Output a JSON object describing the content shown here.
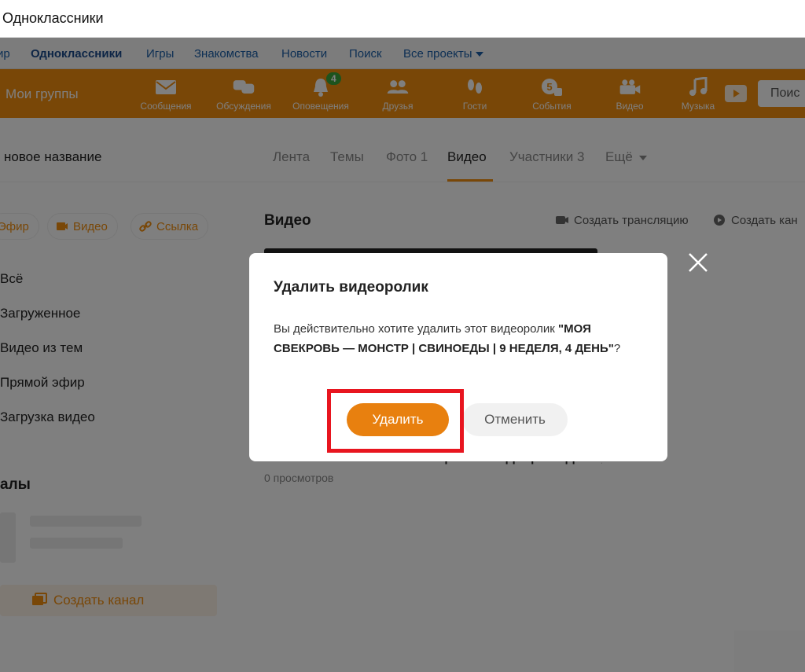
{
  "browser": {
    "title": "Одноклассники"
  },
  "topnav": {
    "items": [
      {
        "label": "ир"
      },
      {
        "label": "Одноклассники",
        "active": true
      },
      {
        "label": "Игры"
      },
      {
        "label": "Знакомства"
      },
      {
        "label": "Новости"
      },
      {
        "label": "Поиск"
      },
      {
        "label": "Все проекты"
      }
    ]
  },
  "toolbar": {
    "group_title": "Мои группы",
    "items": [
      {
        "label": "Сообщения",
        "icon": "envelope-icon"
      },
      {
        "label": "Обсуждения",
        "icon": "chat-bubbles-icon"
      },
      {
        "label": "Оповещения",
        "icon": "bell-icon",
        "badge": "4"
      },
      {
        "label": "Друзья",
        "icon": "friends-icon"
      },
      {
        "label": "Гости",
        "icon": "footprints-icon"
      },
      {
        "label": "События",
        "icon": "events-icon",
        "badge": "5"
      },
      {
        "label": "Видео",
        "icon": "camera-icon"
      },
      {
        "label": "Музыка",
        "icon": "music-note-icon"
      }
    ],
    "search_label": "Поис"
  },
  "group": {
    "name": "новое название",
    "tabs": [
      {
        "label": "Лента"
      },
      {
        "label": "Темы"
      },
      {
        "label": "Фото 1"
      },
      {
        "label": "Видео",
        "active": true
      },
      {
        "label": "Участники 3"
      },
      {
        "label": "Ещё"
      }
    ]
  },
  "left": {
    "pills": [
      {
        "label": "Эфир"
      },
      {
        "label": "Видео"
      },
      {
        "label": "Ссылка"
      }
    ],
    "items": [
      {
        "label": "Всё"
      },
      {
        "label": "Загруженное"
      },
      {
        "label": "Видео из тем"
      },
      {
        "label": "Прямой эфир"
      },
      {
        "label": "Загрузка видео"
      }
    ]
  },
  "channels": {
    "title": "алы",
    "create_label": "Создать канал"
  },
  "main": {
    "title": "Видео",
    "actions": [
      {
        "label": "Создать трансляцию"
      },
      {
        "label": "Создать кан"
      }
    ],
    "video_title": "МОЯ СВЕКРОВЬ — МОНСТР | СВИНОЕДЫ | 9 НЕДЕЛЯ, 4 ДЕНЬ",
    "video_views": "0 просмотров"
  },
  "modal": {
    "title": "Удалить видеоролик",
    "body_prefix": "Вы действительно хотите удалить этот видеоролик ",
    "video_name": "\"МОЯ СВЕКРОВЬ — МОНСТР | СВИНОЕДЫ | 9 НЕДЕЛЯ, 4 ДЕНЬ\"",
    "body_suffix": "?",
    "delete_label": "Удалить",
    "cancel_label": "Отменить"
  },
  "colors": {
    "brand_orange": "#f38f0f",
    "delete_button": "#e8800f",
    "highlight_red": "#e8151f"
  }
}
